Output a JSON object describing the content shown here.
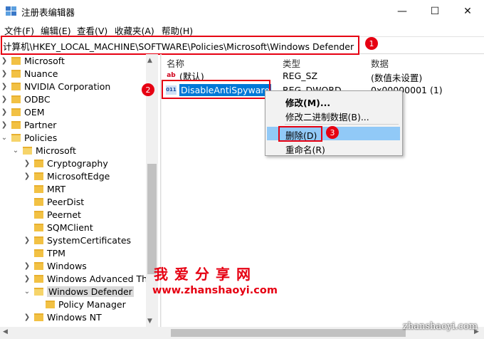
{
  "window": {
    "title": "注册表编辑器",
    "minimize_glyph": "—",
    "maximize_glyph": "☐",
    "close_glyph": "✕"
  },
  "menu": [
    "文件(F)",
    "编辑(E)",
    "查看(V)",
    "收藏夹(A)",
    "帮助(H)"
  ],
  "address": "计算机\\HKEY_LOCAL_MACHINE\\SOFTWARE\\Policies\\Microsoft\\Windows Defender",
  "markers": [
    "1",
    "2",
    "3"
  ],
  "tree": [
    {
      "label": "Microsoft",
      "expanded": false
    },
    {
      "label": "Nuance",
      "expanded": false
    },
    {
      "label": "NVIDIA Corporation",
      "expanded": false
    },
    {
      "label": "ODBC",
      "expanded": false
    },
    {
      "label": "OEM",
      "expanded": false
    },
    {
      "label": "Partner",
      "expanded": false
    },
    {
      "label": "Policies",
      "expanded": true
    },
    {
      "label": "Microsoft",
      "expanded": true
    },
    {
      "label": "Cryptography",
      "expanded": false
    },
    {
      "label": "MicrosoftEdge",
      "expanded": false
    },
    {
      "label": "MRT",
      "expanded": false
    },
    {
      "label": "PeerDist",
      "expanded": false
    },
    {
      "label": "Peernet",
      "expanded": false
    },
    {
      "label": "SQMClient",
      "expanded": false
    },
    {
      "label": "SystemCertificates",
      "expanded": false
    },
    {
      "label": "TPM",
      "expanded": false
    },
    {
      "label": "Windows",
      "expanded": false
    },
    {
      "label": "Windows Advanced Th",
      "expanded": false
    },
    {
      "label": "Windows Defender",
      "expanded": true
    },
    {
      "label": "Policy Manager",
      "expanded": false
    },
    {
      "label": "Windows NT",
      "expanded": false
    }
  ],
  "columns": {
    "name": "名称",
    "type": "类型",
    "data": "数据"
  },
  "values": [
    {
      "name": "(默认)",
      "type": "REG_SZ",
      "data": "(数值未设置)",
      "icon": "ab"
    },
    {
      "name": "DisableAntiSpyware",
      "type": "REG_DWORD",
      "data": "0x00000001 (1)",
      "icon": "011"
    }
  ],
  "context_menu": [
    "修改(M)...",
    "修改二进制数据(B)...",
    "删除(D)",
    "重命名(R)"
  ],
  "watermark": {
    "cn": "我爱分享网",
    "url": "www.zhanshaoyi.com",
    "corner": "zhanshaoyi.com"
  },
  "colors": {
    "accent_red": "#e60012",
    "selection_blue": "#0078d7",
    "menu_highlight": "#91c9f7"
  }
}
